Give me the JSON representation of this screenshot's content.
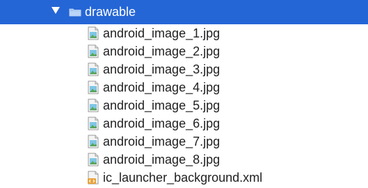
{
  "folder": {
    "name": "drawable",
    "expanded": true,
    "icon": "folder-icon",
    "disclosure_icon": "triangle-down-icon"
  },
  "files": [
    {
      "name": "android_image_1.jpg",
      "icon": "image-file-icon"
    },
    {
      "name": "android_image_2.jpg",
      "icon": "image-file-icon"
    },
    {
      "name": "android_image_3.jpg",
      "icon": "image-file-icon"
    },
    {
      "name": "android_image_4.jpg",
      "icon": "image-file-icon"
    },
    {
      "name": "android_image_5.jpg",
      "icon": "image-file-icon"
    },
    {
      "name": "android_image_6.jpg",
      "icon": "image-file-icon"
    },
    {
      "name": "android_image_7.jpg",
      "icon": "image-file-icon"
    },
    {
      "name": "android_image_8.jpg",
      "icon": "image-file-icon"
    },
    {
      "name": "ic_launcher_background.xml",
      "icon": "xml-file-icon"
    }
  ],
  "colors": {
    "selection": "#2566d6",
    "text": "#1f1f1f",
    "selected_text": "#ffffff"
  }
}
